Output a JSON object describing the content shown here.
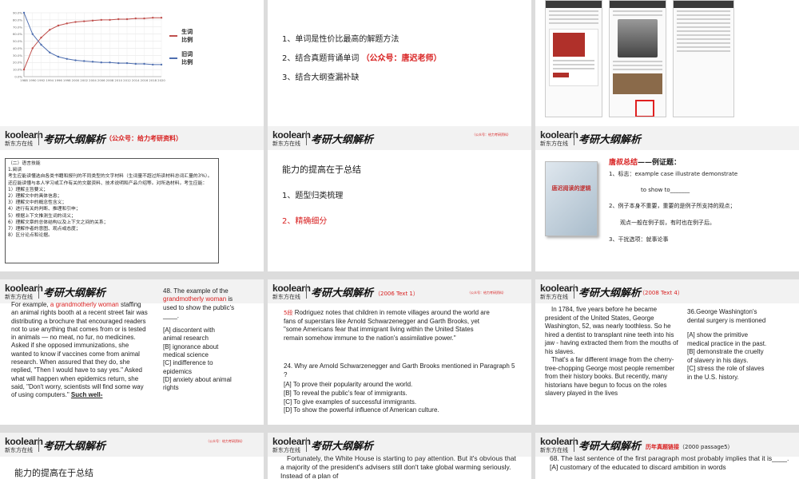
{
  "brand": {
    "logo": "koolearn",
    "logo_sub": "新东方在线",
    "header_title": "考研大纲解析"
  },
  "slide1": {
    "legend_a": "生词比例",
    "legend_b": "旧词比例",
    "chart_data": {
      "type": "line",
      "x": [
        "1988",
        "1990",
        "1992",
        "1994",
        "1996",
        "1998",
        "2000",
        "2002",
        "2004",
        "2006",
        "2008",
        "2010",
        "2012",
        "2014",
        "2016",
        "2018",
        "2020"
      ],
      "series": [
        {
          "name": "生词比例",
          "values": [
            10,
            40,
            55,
            66,
            72,
            75,
            77,
            78,
            79,
            80,
            80,
            81,
            81,
            82,
            82,
            83,
            83
          ],
          "color": "#c0504d"
        },
        {
          "name": "旧词比例",
          "values": [
            90,
            60,
            45,
            34,
            28,
            25,
            23,
            22,
            21,
            20,
            20,
            19,
            19,
            18,
            18,
            17,
            17
          ],
          "color": "#4f6fb0"
        }
      ],
      "ylim": [
        0,
        90
      ],
      "yticks": [
        "0.0%",
        "10.0%",
        "20.0%",
        "30.0%",
        "40.0%",
        "50.0%",
        "60.0%",
        "70.0%",
        "80.0%",
        "90.0%"
      ]
    }
  },
  "slide2": {
    "items": [
      "1、单词是性价比最高的解题方法",
      "2、结合真题背诵单词",
      "3、结合大纲查漏补缺"
    ],
    "note": "（公众号：唐迟老师）"
  },
  "slide4": {
    "tag": "（公众号：给力考研资料）",
    "lines": [
      "（二）语言技能",
      "1.阅读",
      "考生应能读懂选自各类书籍和报刊的不同类型的文字材料（生词量不超过所读材料总词汇量的3%）。",
      "还应能读懂与本人学习或工作有关的文献资料、技术说明和产品介绍等。对所选材料，考生应能：",
      "1）理解主旨要义；",
      "2）理解文中的具体信息；",
      "3）理解文中的概念性含义；",
      "4）进行有关的判断、推理和引申；",
      "5）根据上下文推测生词的词义；",
      "6）理解文章的总体结构以及上下文之间的关系；",
      "7）理解作者的意图、观点或态度；",
      "8）区分论点和论据。"
    ]
  },
  "slide5": {
    "title": "能力的提高在于总结",
    "items": [
      "1、题型归类梳理",
      "2、精确细分"
    ],
    "tag": "（公众号：给力考研资料）"
  },
  "slide6": {
    "heading_red": "唐叔总结",
    "heading_dash": "——",
    "heading_black": "例证题：",
    "p1": "1、标志：example case illustrate demonstrate",
    "p1b": "to show    to_______",
    "p2": "2、例子本身不重要，重要的是例子所支持的观点；",
    "p3": "观点一般在例子前，有时也在例子后。",
    "p4": "3、干扰选项：就事论事",
    "book_title": "唐迟阅读的逻辑"
  },
  "slide7": {
    "passage_pre": "For example, ",
    "passage_red": "a grandmotherly woman",
    "passage_post": " staffing an animal rights booth at a recent street fair was distributing a brochure that encouraged readers not to use anything that comes from or is tested in animals — no meat, no fur, no medicines. Asked if she opposed immunizations, she wanted to know if vaccines come from animal research. When assured that they do, she replied, \"Then I would have to say yes.\" Asked what will happen when epidemics return, she said, \"Don't worry, scientists will find some way of using computers.\" ",
    "passage_bold": "Such well-",
    "q_pre": "48. The example of the ",
    "q_red": "grandmotherly woman",
    "q_post": " is used to show the public's ____.",
    "options": [
      "[A] discontent with animal research",
      "[B] ignorance about medical science",
      "[C] indifference to epidemics",
      "[D] anxiety about animal rights"
    ]
  },
  "slide8": {
    "tag": "（2006 Text 1）",
    "tag2": "（公众号：给力考研资料）",
    "para_label": "5段",
    "para": "Rodriguez notes that children in remote villages around the world are fans of superstars like Arnold Schwarzenegger and Garth Brooks, yet \"some Americans fear that immigrant living within the United States remain somehow immune to the nation's assimilative power.\"",
    "question": "24. Why are Arnold Schwarzenegger and Garth Brooks mentioned in Paragraph 5 ?",
    "options": [
      "[A] To prove their popularity around the world.",
      "[B] To reveal the public's fear of immigrants.",
      "[C] To give examples of successful immigrants.",
      "[D] To show the powerful influence of American culture."
    ]
  },
  "slide9": {
    "tag": "（2008 Text 4）",
    "passage": "In 1784, five years before he became president of the United States, George Washington, 52, was nearly toothless. So he hired a dentist to transplant nine teeth into his jaw - having extracted them from the mouths of his slaves.",
    "passage2": "That's a far different image from the cherry-tree-chopping George most people remember from their history books. But recently, many historians have begun to focus on the roles slavery played in the lives",
    "question": "36.George Washington's dental surgery is mentioned",
    "options": [
      "[A] show the primitive medical practice in the past.",
      "[B] demonstrate the cruelty of slavery in his days.",
      "[C] stress the role of slaves in the U.S. history."
    ]
  },
  "slide10": {
    "title": "能力的提高在于总结",
    "tag": "（公众号：给力考研资料）"
  },
  "slide11": {
    "passage": "Fortunately, the White House is starting to pay attention. But it's obvious that a majority of the president's advisers still don't take global warming seriously. Instead of a plan of"
  },
  "slide12": {
    "tag_red": "历年真题链接",
    "tag": "（2000 passage5）",
    "question": "68. The last sentence of the first paragraph most probably implies that it is____.",
    "option_a": "[A] customary of the educated to discard ambition in words"
  }
}
